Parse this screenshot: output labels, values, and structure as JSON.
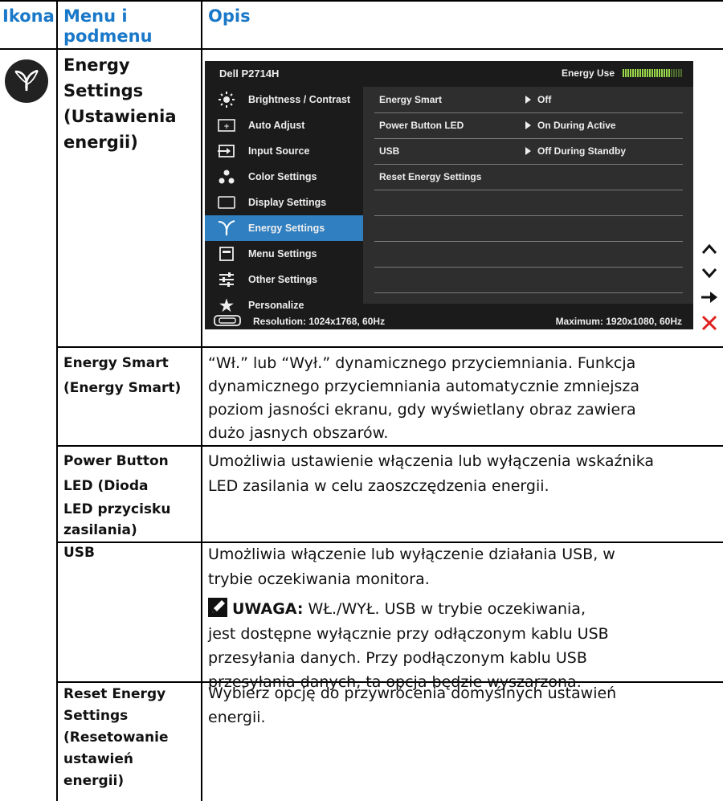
{
  "header": {
    "col1": "Ikona",
    "col2_line1": "Menu i",
    "col2_line2": "podmenu",
    "col3": "Opis"
  },
  "main_row": {
    "icon": "leaf-energy-icon",
    "label_lines": [
      "Energy",
      "Settings",
      "(Ustawienia",
      "energii)"
    ]
  },
  "osd": {
    "model": "Dell P2714H",
    "energy_use_label": "Energy Use",
    "menu": [
      {
        "label": "Brightness / Contrast",
        "icon": "brightness-icon"
      },
      {
        "label": "Auto Adjust",
        "icon": "auto-adjust-icon"
      },
      {
        "label": "Input Source",
        "icon": "input-source-icon"
      },
      {
        "label": "Color Settings",
        "icon": "color-settings-icon"
      },
      {
        "label": "Display Settings",
        "icon": "display-settings-icon"
      },
      {
        "label": "Energy Settings",
        "icon": "leaf-icon",
        "selected": true
      },
      {
        "label": "Menu Settings",
        "icon": "menu-settings-icon"
      },
      {
        "label": "Other Settings",
        "icon": "other-settings-icon"
      },
      {
        "label": "Personalize",
        "icon": "star-icon"
      }
    ],
    "submenu": [
      {
        "label": "Energy Smart",
        "value": "Off"
      },
      {
        "label": "Power Button LED",
        "value": "On During Active"
      },
      {
        "label": "USB",
        "value": "Off During Standby"
      },
      {
        "label": "Reset Energy Settings",
        "value": ""
      }
    ],
    "resolution": "Resolution: 1024x1768, 60Hz",
    "maximum": "Maximum: 1920x1080, 60Hz",
    "accent_color": "#2f7fc1"
  },
  "rows": [
    {
      "label_lines": [
        "Energy Smart",
        "(Energy Smart)"
      ],
      "desc_lines": [
        "“Wł.” lub “Wył.” dynamicznego przyciemniania. Funkcja",
        "dynamicznego przyciemniania automatycznie zmniejsza",
        "poziom jasności ekranu, gdy wyświetlany obraz zawiera",
        "dużo jasnych obszarów."
      ]
    },
    {
      "label_lines": [
        "Power Button",
        "LED (Dioda",
        "LED przycisku",
        "zasilania)"
      ],
      "desc_lines": [
        "Umożliwia ustawienie włączenia lub wyłączenia wskaźnika",
        "LED zasilania w celu zaoszczędzenia energii."
      ]
    },
    {
      "label_lines": [
        "USB"
      ],
      "desc_lines": [
        "Umożliwia włączenie lub wyłączenie działania USB, w",
        "trybie oczekiwania monitora."
      ],
      "note_label": "UWAGA:",
      "note_first": " WŁ./WYŁ. USB w trybie oczekiwania,",
      "note_lines": [
        "jest dostępne wyłącznie przy odłączonym kablu USB",
        "przesyłania danych. Przy podłączonym kablu USB",
        "przesyłania danych, ta opcja będzie wyszarzona."
      ]
    },
    {
      "label_lines": [
        "Reset Energy",
        "Settings",
        "(Resetowanie",
        "ustawień",
        "energii)"
      ],
      "desc_lines": [
        "Wybierz opcję do przywrócenia domyślnych ustawień",
        "energii."
      ]
    }
  ]
}
